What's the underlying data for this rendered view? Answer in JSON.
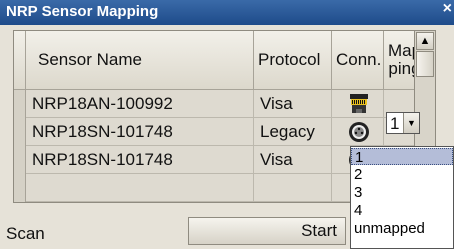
{
  "dialog": {
    "title": "NRP Sensor Mapping",
    "close_glyph": "×"
  },
  "table": {
    "columns": {
      "sensor_name": "Sensor Name",
      "protocol": "Protocol",
      "conn": "Conn.",
      "mapping_line1": "Map",
      "mapping_line2": "ping"
    },
    "rows": [
      {
        "sensor_name": "NRP18AN-100992",
        "protocol": "Visa",
        "conn_icon": "lan-connector-icon",
        "mapping": ""
      },
      {
        "sensor_name": "NRP18SN-101748",
        "protocol": "Legacy",
        "conn_icon": "usb-round-connector-icon",
        "mapping": "1"
      },
      {
        "sensor_name": "NRP18SN-101748",
        "protocol": "Visa",
        "conn_icon": "usb-round-connector-icon",
        "mapping": ""
      },
      {
        "sensor_name": "",
        "protocol": "",
        "conn_icon": "",
        "mapping": ""
      }
    ]
  },
  "mapping_combo": {
    "value": "1",
    "options": [
      "1",
      "2",
      "3",
      "4",
      "unmapped"
    ],
    "highlighted_index": 0
  },
  "scan": {
    "label": "Scan",
    "start_button": "Start"
  },
  "colors": {
    "title_bar": "#1e4b8a",
    "dialog_bg": "#e6e2d8",
    "selection": "#b4bdd8"
  }
}
